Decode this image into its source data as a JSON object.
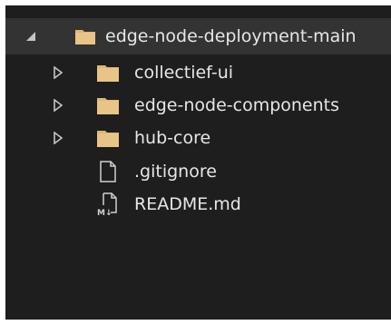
{
  "explorer": {
    "root": {
      "label": "edge-node-deployment-main",
      "state": "expanded",
      "icon": "folder-icon"
    },
    "items": [
      {
        "label": "collectief-ui",
        "type": "folder",
        "state": "collapsed",
        "icon": "folder-icon"
      },
      {
        "label": "edge-node-components",
        "type": "folder",
        "state": "collapsed",
        "icon": "folder-icon"
      },
      {
        "label": "hub-core",
        "type": "folder",
        "state": "collapsed",
        "icon": "folder-icon"
      },
      {
        "label": ".gitignore",
        "type": "file",
        "icon": "file-icon"
      },
      {
        "label": "README.md",
        "type": "file",
        "icon": "markdown-file-icon",
        "icon_text": "M↓"
      }
    ]
  },
  "colors": {
    "panel_background": "#1e1e1e",
    "selected_row": "#333333",
    "folder": "#dcb67a",
    "text": "#e6e6e6",
    "twisty": "#c5c5c5"
  }
}
